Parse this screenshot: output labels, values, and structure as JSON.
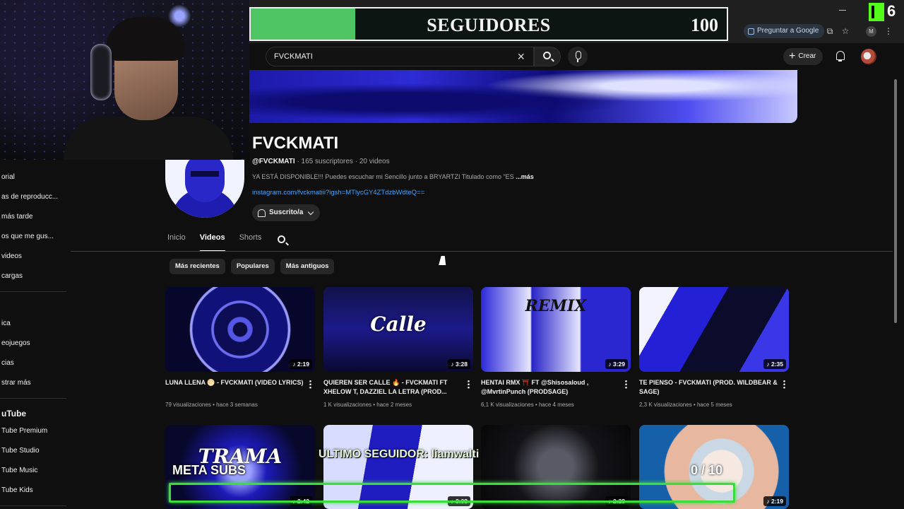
{
  "browser": {
    "google_button": "Preguntar a Google",
    "profile_initial": "M"
  },
  "overlay": {
    "followers_label": "SEGUIDORES",
    "followers_count": "100",
    "followers_progress": 0.22,
    "platform_count": "6",
    "meta_label": "META SUBS",
    "last_follower": "ULTIMO SEGUIDOR: liamwalti",
    "subs_count": "0 / 10",
    "subs_progress": 0.0
  },
  "topbar": {
    "search_value": "FVCKMATI",
    "create_label": "Crear"
  },
  "sidebar": {
    "items": [
      "orial",
      "as de reproducc...",
      "más tarde",
      "os que me gus...",
      "videos",
      "cargas"
    ],
    "items2": [
      "ica",
      "eojuegos",
      "cias",
      "strar más"
    ],
    "heading": "uTube",
    "items3": [
      "Tube Premium",
      "Tube Studio",
      "Tube Music",
      "Tube Kids"
    ]
  },
  "channel": {
    "name": "FVCKMATI",
    "handle": "@FVCKMATI",
    "stats": " · 165 suscriptores · 20 videos",
    "description": "YA ESTÁ DISPONIBLE!!! Puedes escuchar mi Sencillo junto a BRYARTZI Titulado como \"ES",
    "more": "...más",
    "link": "instagram.com/fvckmatiii?igsh=MTlycGY4ZTdzbWdteQ==",
    "subscribe_label": "Suscrito/a"
  },
  "tabs": [
    "Inicio",
    "Videos",
    "Shorts"
  ],
  "chips": [
    "Más recientes",
    "Populares",
    "Más antiguos"
  ],
  "videos": [
    {
      "title": "LUNA LLENA 🌕 - FVCKMATI (VIDEO LYRICS)",
      "meta": "79 visualizaciones • hace 3 semanas",
      "duration": "♪ 2:19"
    },
    {
      "title": "QUIEREN SER CALLE 🔥 - FVCKMATI FT XHELOW T, DAZZIEL LA LETRA (PROD...",
      "meta": "1 K visualizaciones • hace 2 meses",
      "duration": "♪ 3:28"
    },
    {
      "title": "HENTAI RMX ⛩️ FT @Shisosaloud , @MvrtinPunch (PRODSAGE)",
      "meta": "6,1 K visualizaciones • hace 4 meses",
      "duration": "♪ 3:29"
    },
    {
      "title": "TE PIENSO - FVCKMATI (PROD. WILDBEAR & SAGE)",
      "meta": "2,3 K visualizaciones • hace 5 meses",
      "duration": "♪ 2:35"
    },
    {
      "title": "",
      "meta": "",
      "duration": "♪ 2:42"
    },
    {
      "title": "",
      "meta": "",
      "duration": "♪ 3:08"
    },
    {
      "title": "",
      "meta": "",
      "duration": "♪ 2:28"
    },
    {
      "title": "",
      "meta": "",
      "duration": "♪ 2:19"
    }
  ],
  "thumb_text": {
    "t2": "Calle",
    "t3": "REMIX",
    "t5": "TRAMA"
  }
}
